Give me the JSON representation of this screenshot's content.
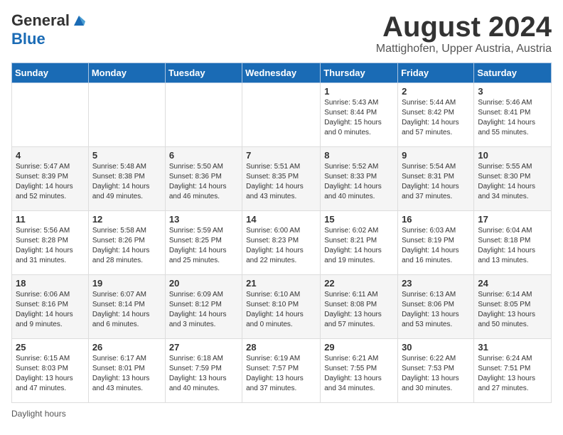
{
  "header": {
    "logo_general": "General",
    "logo_blue": "Blue",
    "month_title": "August 2024",
    "location": "Mattighofen, Upper Austria, Austria"
  },
  "weekdays": [
    "Sunday",
    "Monday",
    "Tuesday",
    "Wednesday",
    "Thursday",
    "Friday",
    "Saturday"
  ],
  "footer": {
    "daylight_label": "Daylight hours"
  },
  "weeks": [
    [
      {
        "day": "",
        "info": ""
      },
      {
        "day": "",
        "info": ""
      },
      {
        "day": "",
        "info": ""
      },
      {
        "day": "",
        "info": ""
      },
      {
        "day": "1",
        "info": "Sunrise: 5:43 AM\nSunset: 8:44 PM\nDaylight: 15 hours\nand 0 minutes."
      },
      {
        "day": "2",
        "info": "Sunrise: 5:44 AM\nSunset: 8:42 PM\nDaylight: 14 hours\nand 57 minutes."
      },
      {
        "day": "3",
        "info": "Sunrise: 5:46 AM\nSunset: 8:41 PM\nDaylight: 14 hours\nand 55 minutes."
      }
    ],
    [
      {
        "day": "4",
        "info": "Sunrise: 5:47 AM\nSunset: 8:39 PM\nDaylight: 14 hours\nand 52 minutes."
      },
      {
        "day": "5",
        "info": "Sunrise: 5:48 AM\nSunset: 8:38 PM\nDaylight: 14 hours\nand 49 minutes."
      },
      {
        "day": "6",
        "info": "Sunrise: 5:50 AM\nSunset: 8:36 PM\nDaylight: 14 hours\nand 46 minutes."
      },
      {
        "day": "7",
        "info": "Sunrise: 5:51 AM\nSunset: 8:35 PM\nDaylight: 14 hours\nand 43 minutes."
      },
      {
        "day": "8",
        "info": "Sunrise: 5:52 AM\nSunset: 8:33 PM\nDaylight: 14 hours\nand 40 minutes."
      },
      {
        "day": "9",
        "info": "Sunrise: 5:54 AM\nSunset: 8:31 PM\nDaylight: 14 hours\nand 37 minutes."
      },
      {
        "day": "10",
        "info": "Sunrise: 5:55 AM\nSunset: 8:30 PM\nDaylight: 14 hours\nand 34 minutes."
      }
    ],
    [
      {
        "day": "11",
        "info": "Sunrise: 5:56 AM\nSunset: 8:28 PM\nDaylight: 14 hours\nand 31 minutes."
      },
      {
        "day": "12",
        "info": "Sunrise: 5:58 AM\nSunset: 8:26 PM\nDaylight: 14 hours\nand 28 minutes."
      },
      {
        "day": "13",
        "info": "Sunrise: 5:59 AM\nSunset: 8:25 PM\nDaylight: 14 hours\nand 25 minutes."
      },
      {
        "day": "14",
        "info": "Sunrise: 6:00 AM\nSunset: 8:23 PM\nDaylight: 14 hours\nand 22 minutes."
      },
      {
        "day": "15",
        "info": "Sunrise: 6:02 AM\nSunset: 8:21 PM\nDaylight: 14 hours\nand 19 minutes."
      },
      {
        "day": "16",
        "info": "Sunrise: 6:03 AM\nSunset: 8:19 PM\nDaylight: 14 hours\nand 16 minutes."
      },
      {
        "day": "17",
        "info": "Sunrise: 6:04 AM\nSunset: 8:18 PM\nDaylight: 14 hours\nand 13 minutes."
      }
    ],
    [
      {
        "day": "18",
        "info": "Sunrise: 6:06 AM\nSunset: 8:16 PM\nDaylight: 14 hours\nand 9 minutes."
      },
      {
        "day": "19",
        "info": "Sunrise: 6:07 AM\nSunset: 8:14 PM\nDaylight: 14 hours\nand 6 minutes."
      },
      {
        "day": "20",
        "info": "Sunrise: 6:09 AM\nSunset: 8:12 PM\nDaylight: 14 hours\nand 3 minutes."
      },
      {
        "day": "21",
        "info": "Sunrise: 6:10 AM\nSunset: 8:10 PM\nDaylight: 14 hours\nand 0 minutes."
      },
      {
        "day": "22",
        "info": "Sunrise: 6:11 AM\nSunset: 8:08 PM\nDaylight: 13 hours\nand 57 minutes."
      },
      {
        "day": "23",
        "info": "Sunrise: 6:13 AM\nSunset: 8:06 PM\nDaylight: 13 hours\nand 53 minutes."
      },
      {
        "day": "24",
        "info": "Sunrise: 6:14 AM\nSunset: 8:05 PM\nDaylight: 13 hours\nand 50 minutes."
      }
    ],
    [
      {
        "day": "25",
        "info": "Sunrise: 6:15 AM\nSunset: 8:03 PM\nDaylight: 13 hours\nand 47 minutes."
      },
      {
        "day": "26",
        "info": "Sunrise: 6:17 AM\nSunset: 8:01 PM\nDaylight: 13 hours\nand 43 minutes."
      },
      {
        "day": "27",
        "info": "Sunrise: 6:18 AM\nSunset: 7:59 PM\nDaylight: 13 hours\nand 40 minutes."
      },
      {
        "day": "28",
        "info": "Sunrise: 6:19 AM\nSunset: 7:57 PM\nDaylight: 13 hours\nand 37 minutes."
      },
      {
        "day": "29",
        "info": "Sunrise: 6:21 AM\nSunset: 7:55 PM\nDaylight: 13 hours\nand 34 minutes."
      },
      {
        "day": "30",
        "info": "Sunrise: 6:22 AM\nSunset: 7:53 PM\nDaylight: 13 hours\nand 30 minutes."
      },
      {
        "day": "31",
        "info": "Sunrise: 6:24 AM\nSunset: 7:51 PM\nDaylight: 13 hours\nand 27 minutes."
      }
    ]
  ]
}
